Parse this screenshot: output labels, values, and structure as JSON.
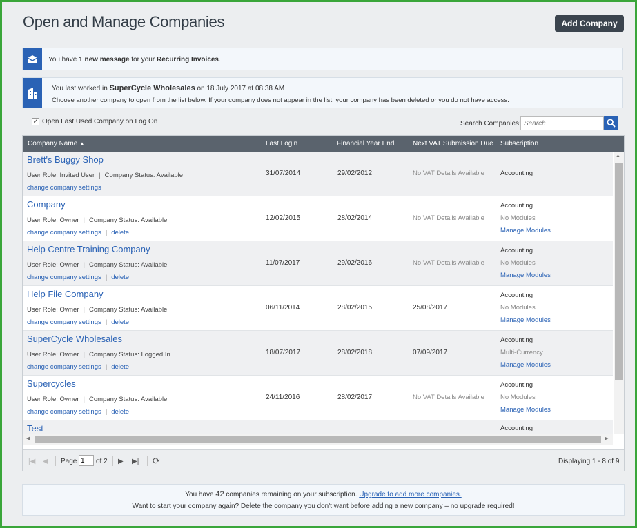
{
  "header": {
    "title": "Open and Manage Companies",
    "add_button": "Add Company"
  },
  "messages": {
    "new_message": {
      "pre": "You have ",
      "count": "1 new message",
      "mid": " for your ",
      "target": "Recurring Invoices",
      "post": "."
    },
    "last_worked": {
      "pre": "You last worked in ",
      "company": "SuperCycle Wholesales",
      "post": " on 18 July 2017 at 08:38 AM",
      "line2": "Choose another company to open from the list below. If your company does not appear in the list, your company has been deleted or you do not have access."
    }
  },
  "options": {
    "open_last_used_label": "Open Last Used Company on Log On",
    "open_last_used_checked": true
  },
  "search": {
    "label": "Search Companies:",
    "placeholder": "Search"
  },
  "grid": {
    "columns": {
      "name": "Company Name",
      "last_login": "Last Login",
      "fye": "Financial Year End",
      "vat": "Next VAT Submission Due",
      "subscription": "Subscription"
    },
    "rows": [
      {
        "name": "Brett's Buggy Shop",
        "role": "User Role: Invited User",
        "status": "Company Status: Available",
        "link_settings": "change company settings",
        "link_delete": "",
        "last_login": "31/07/2014",
        "fye": "29/02/2012",
        "vat": "No VAT Details Available",
        "sub1": "Accounting",
        "sub2": "",
        "sub3": ""
      },
      {
        "name": "Company",
        "role": "User Role: Owner",
        "status": "Company Status: Available",
        "link_settings": "change company settings",
        "link_delete": "delete",
        "last_login": "12/02/2015",
        "fye": "28/02/2014",
        "vat": "No VAT Details Available",
        "sub1": "Accounting",
        "sub2": "No Modules",
        "sub3": "Manage Modules"
      },
      {
        "name": "Help Centre Training Company",
        "role": "User Role: Owner",
        "status": "Company Status: Available",
        "link_settings": "change company settings",
        "link_delete": "delete",
        "last_login": "11/07/2017",
        "fye": "29/02/2016",
        "vat": "No VAT Details Available",
        "sub1": "Accounting",
        "sub2": "No Modules",
        "sub3": "Manage Modules"
      },
      {
        "name": "Help File Company",
        "role": "User Role: Owner",
        "status": "Company Status: Available",
        "link_settings": "change company settings",
        "link_delete": "delete",
        "last_login": "06/11/2014",
        "fye": "28/02/2015",
        "vat": "25/08/2017",
        "sub1": "Accounting",
        "sub2": "No Modules",
        "sub3": "Manage Modules"
      },
      {
        "name": "SuperCycle Wholesales",
        "role": "User Role: Owner",
        "status": "Company Status: Logged In",
        "link_settings": "change company settings",
        "link_delete": "delete",
        "last_login": "18/07/2017",
        "fye": "28/02/2018",
        "vat": "07/09/2017",
        "sub1": "Accounting",
        "sub2": "Multi-Currency",
        "sub3": "Manage Modules"
      },
      {
        "name": "Supercycles",
        "role": "User Role: Owner",
        "status": "Company Status: Available",
        "link_settings": "change company settings",
        "link_delete": "delete",
        "last_login": "24/11/2016",
        "fye": "28/02/2017",
        "vat": "No VAT Details Available",
        "sub1": "Accounting",
        "sub2": "No Modules",
        "sub3": "Manage Modules"
      },
      {
        "name": "Test",
        "role": "",
        "status": "",
        "link_settings": "",
        "link_delete": "",
        "last_login": "",
        "fye": "",
        "vat": "",
        "sub1": "Accounting",
        "sub2": "",
        "sub3": ""
      }
    ]
  },
  "pager": {
    "page_label": "Page",
    "page_value": "1",
    "of_label": "of 2",
    "displaying": "Displaying 1 - 8 of 9"
  },
  "footer": {
    "pre": "You have ",
    "count": "42",
    "mid": " companies remaining on your subscription. ",
    "upgrade_link": "Upgrade to add more companies.",
    "line2": "Want to start your company again? Delete the company you don't want before adding a new company – no upgrade required!"
  },
  "colors": {
    "accent": "#2a62b5",
    "header_bg": "#5a636d",
    "button_bg": "#3b444e",
    "frame": "#3aa63a"
  }
}
